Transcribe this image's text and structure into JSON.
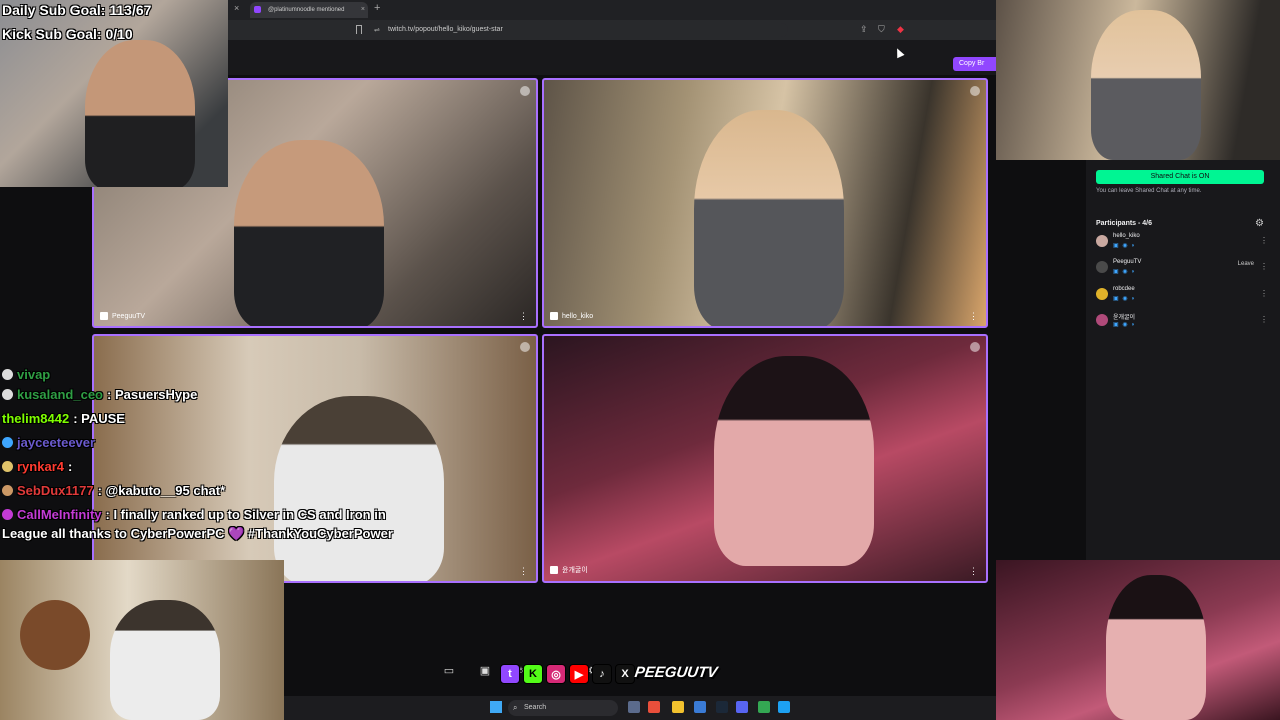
{
  "browser": {
    "tab_title": "@platinumnoodle mentioned",
    "url": "twitch.tv/popout/hello_kiko/guest-star",
    "copy_button": "Copy Br"
  },
  "goals": {
    "daily": "Daily Sub Goal: 113/67",
    "kick": "Kick Sub Goal: 0/10"
  },
  "tiles": [
    {
      "name": "PeeguuTV"
    },
    {
      "name": "hello_kiko"
    },
    {
      "name": ""
    },
    {
      "name": "윤개굴이"
    }
  ],
  "sidebar": {
    "shared_chat_header": "Shared Chat",
    "shared_chat_status": "Shared Chat is ON",
    "shared_chat_note": "You can leave Shared Chat at any time.",
    "participants_title": "Participants - 4/6",
    "participants": [
      {
        "name": "hello_kiko",
        "avatar_color": "#c9a8a0",
        "leave": ""
      },
      {
        "name": "PeeguuTV",
        "avatar_color": "#4a4a4a",
        "leave": "Leave"
      },
      {
        "name": "robcdee",
        "avatar_color": "#e0b22a",
        "leave": ""
      },
      {
        "name": "윤개굴이",
        "avatar_color": "#b04a7a",
        "leave": ""
      }
    ]
  },
  "chat": [
    {
      "user": "vivap",
      "color": "#2f9e44",
      "message": ""
    },
    {
      "user": "kusaland_ceo",
      "color": "#2f9e44",
      "message": ": PasuersHype"
    },
    {
      "user": "thelim8442",
      "color": "#7fff00",
      "message": ": PAUSE"
    },
    {
      "user": "jayceeteever",
      "color": "#6a5acd",
      "message": ""
    },
    {
      "user": "rynkar4",
      "color": "#ff3b30",
      "message": ":"
    },
    {
      "user": "SebDux1177",
      "color": "#e03a3a",
      "message": ": @kabuto__95 chat*"
    },
    {
      "user": "CallMeInfinity",
      "color": "#c43bd6",
      "message": ": I finally ranked up to Silver in CS and Iron in"
    }
  ],
  "chat_continuation": "League all thanks to CyberPowerPC 💜 #ThankYouCyberPower",
  "branding": {
    "logo_text": "PEEGUUTV",
    "social": [
      {
        "icon": "twitch-icon",
        "glyph": "t",
        "color": "#9147ff"
      },
      {
        "icon": "kick-icon",
        "glyph": "K",
        "color": "#53fc18"
      },
      {
        "icon": "instagram-icon",
        "glyph": "◎",
        "color": "#d62976"
      },
      {
        "icon": "youtube-icon",
        "glyph": "▶",
        "color": "#ff0000"
      },
      {
        "icon": "tiktok-icon",
        "glyph": "♪",
        "color": "#111111"
      },
      {
        "icon": "x-icon",
        "glyph": "X",
        "color": "#111111"
      }
    ]
  },
  "taskbar": {
    "search_placeholder": "Search"
  }
}
